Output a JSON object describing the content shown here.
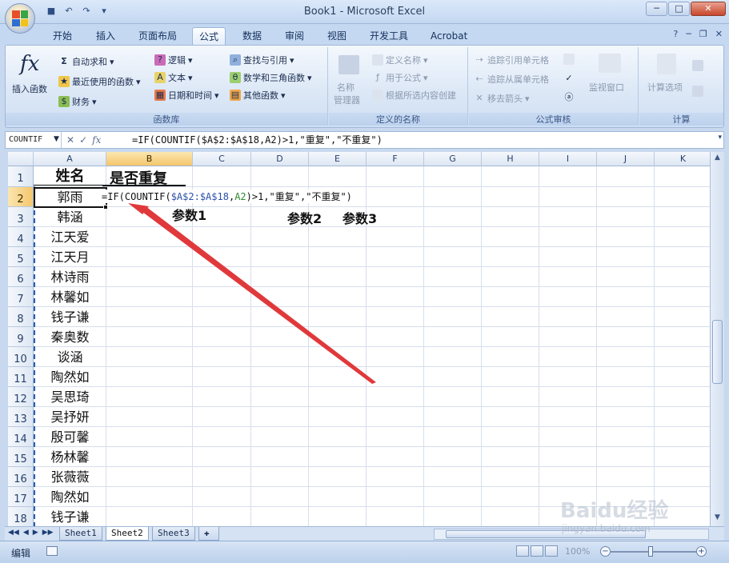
{
  "window": {
    "title": "Book1 - Microsoft Excel"
  },
  "tabs": [
    {
      "label": "开始"
    },
    {
      "label": "插入"
    },
    {
      "label": "页面布局"
    },
    {
      "label": "公式"
    },
    {
      "label": "数据"
    },
    {
      "label": "审阅"
    },
    {
      "label": "视图"
    },
    {
      "label": "开发工具"
    },
    {
      "label": "Acrobat"
    }
  ],
  "ribbon": {
    "function_library": {
      "label": "函数库",
      "insert_function": "插入函数",
      "autosum": "自动求和",
      "recently_used": "最近使用的函数",
      "financial": "财务",
      "logical": "逻辑",
      "text": "文本",
      "date_time": "日期和时间",
      "lookup_reference": "查找与引用",
      "math_trig": "数学和三角函数",
      "more_functions": "其他函数"
    },
    "defined_names": {
      "label": "定义的名称",
      "name_manager_1": "名称",
      "name_manager_2": "管理器",
      "define_name": "定义名称",
      "use_in_formula": "用于公式",
      "create_from_selection": "根据所选内容创建"
    },
    "formula_auditing": {
      "label": "公式审核",
      "trace_precedents": "追踪引用单元格",
      "trace_dependents": "追踪从属单元格",
      "remove_arrows": "移去箭头",
      "watch_window": "监视窗口"
    },
    "calculation": {
      "label": "计算",
      "calc_options": "计算选项"
    }
  },
  "formula_bar": {
    "name_box": "COUNTIF",
    "formula": "=IF(COUNTIF($A$2:$A$18,A2)>1,\"重复\",\"不重复\")"
  },
  "sheet": {
    "columns": [
      "A",
      "B",
      "C",
      "D",
      "E",
      "F",
      "G",
      "H",
      "I",
      "J",
      "K"
    ],
    "rows": [
      "1",
      "2",
      "3",
      "4",
      "5",
      "6",
      "7",
      "8",
      "9",
      "10",
      "11",
      "12",
      "13",
      "14",
      "15",
      "16",
      "17",
      "18"
    ],
    "header_a": "姓名",
    "header_b": "是否重复",
    "names": [
      "郭雨",
      "韩涵",
      "江天爱",
      "江天月",
      "林诗雨",
      "林馨如",
      "钱子谦",
      "秦奥数",
      "谈涵",
      "陶然如",
      "吴思琦",
      "吴抒妍",
      "殷可馨",
      "杨林馨",
      "张薇薇",
      "陶然如",
      "钱子谦"
    ],
    "edit_formula": {
      "prefix": "=IF(COUNTIF(",
      "range": "$A$2:$A$18",
      "comma": ",",
      "ref": "A2",
      "suffix": ")>1,\"重复\",\"不重复\")"
    },
    "annotations": {
      "param1": "参数1",
      "param2": "参数2",
      "param3": "参数3"
    }
  },
  "sheet_tabs": [
    {
      "label": "Sheet1"
    },
    {
      "label": "Sheet2"
    },
    {
      "label": "Sheet3"
    }
  ],
  "status": {
    "mode": "编辑",
    "zoom": "100%"
  },
  "watermark": {
    "brand": "Baidu经验",
    "url": "jingyan.baidu.com"
  },
  "colors": {
    "accent_blue": "#c4d8f1",
    "arrow_red": "#e0393b",
    "selection_orange": "#f4c66c"
  }
}
